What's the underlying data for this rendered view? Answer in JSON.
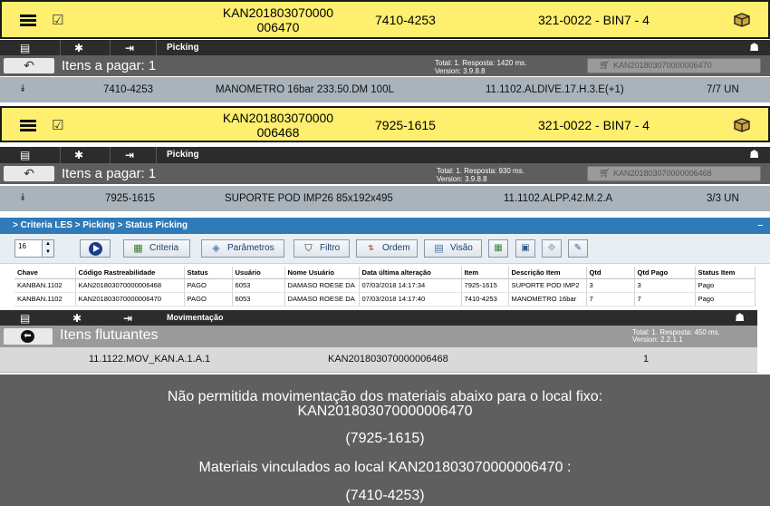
{
  "picking_1": {
    "kanban_line1": "KAN201803070000",
    "kanban_line2": "006470",
    "item": "7410-4253",
    "location": "321-0022 - BIN7 - 4",
    "toolbar_title": "Picking",
    "panel_title": "Itens a pagar: 1",
    "total_line1": "Total: 1. Resposta: 1420 ms.",
    "total_line2": "Version: 3.9.8.8",
    "kanban_button": "KAN201803070000006470",
    "row": {
      "item": "7410-4253",
      "description": "MANOMETRO 16bar 233.50.DM 100L",
      "address": "11.1102.ALDIVE.17.H.3.E(+1)",
      "qty": "7/7 UN"
    }
  },
  "picking_2": {
    "kanban_line1": "KAN201803070000",
    "kanban_line2": "006468",
    "item": "7925-1615",
    "location": "321-0022 - BIN7 - 4",
    "toolbar_title": "Picking",
    "panel_title": "Itens a pagar: 1",
    "total_line1": "Total: 1. Resposta: 930 ms.",
    "total_line2": "Version: 3.9.8.8",
    "kanban_button": "KAN201803070000006468",
    "row": {
      "item": "7925-1615",
      "description": "SUPORTE POD IMP26 85x192x495",
      "address": "11.1102.ALPP.42.M.2.A",
      "qty": "3/3 UN"
    }
  },
  "criteria": {
    "breadcrumb": "> Criteria LES > Picking > Status Picking",
    "collapse": "–",
    "page_size": "16",
    "buttons": {
      "criteria": "Criteria",
      "parametros": "Parâmetros",
      "filtro": "Filtro",
      "ordem": "Ordem",
      "visao": "Visão"
    },
    "columns": [
      "Chave",
      "Código Rastreabilidade",
      "Status",
      "Usuário",
      "Nome Usuário",
      "Data última alteração",
      "Item",
      "Descrição Item",
      "Qtd",
      "Qtd Pago",
      "Status Item"
    ],
    "rows": [
      [
        "KANBAN.1102",
        "KAN201803070000006468",
        "PAGO",
        "6053",
        "DAMASO ROESE DA",
        "07/03/2018 14:17:34",
        "7925-1615",
        "SUPORTE POD IMP2",
        "3",
        "3",
        "Pago"
      ],
      [
        "KANBAN.1102",
        "KAN201803070000006470",
        "PAGO",
        "6053",
        "DAMASO ROESE DA",
        "07/03/2018 14:17:40",
        "7410-4253",
        "MANOMETRO 16bar",
        "7",
        "7",
        "Pago"
      ]
    ]
  },
  "movimentacao": {
    "toolbar_title": "Movimentação",
    "panel_title": "Itens flutuantes",
    "total_line1": "Total: 1. Resposta: 450 ms.",
    "total_line2": "Version: 2.2.1.1",
    "row": {
      "address": "11.1122.MOV_KAN.A.1.A.1",
      "kanban": "KAN201803070000006468",
      "qty": "1"
    }
  },
  "message": {
    "line1": "Não permitida movimentação dos materiais abaixo para o local fixo:",
    "line2": "KAN201803070000006470",
    "line3": "(7925-1615)",
    "line4": "Materiais vinculados ao local KAN201803070000006470 :",
    "line5": "(7410-4253)"
  },
  "icons": {
    "menu": "menu-icon",
    "settings": "gear-icon",
    "exit": "exit-icon",
    "back": "back-arrow-icon",
    "cart": "cart-icon",
    "box": "box-icon"
  }
}
